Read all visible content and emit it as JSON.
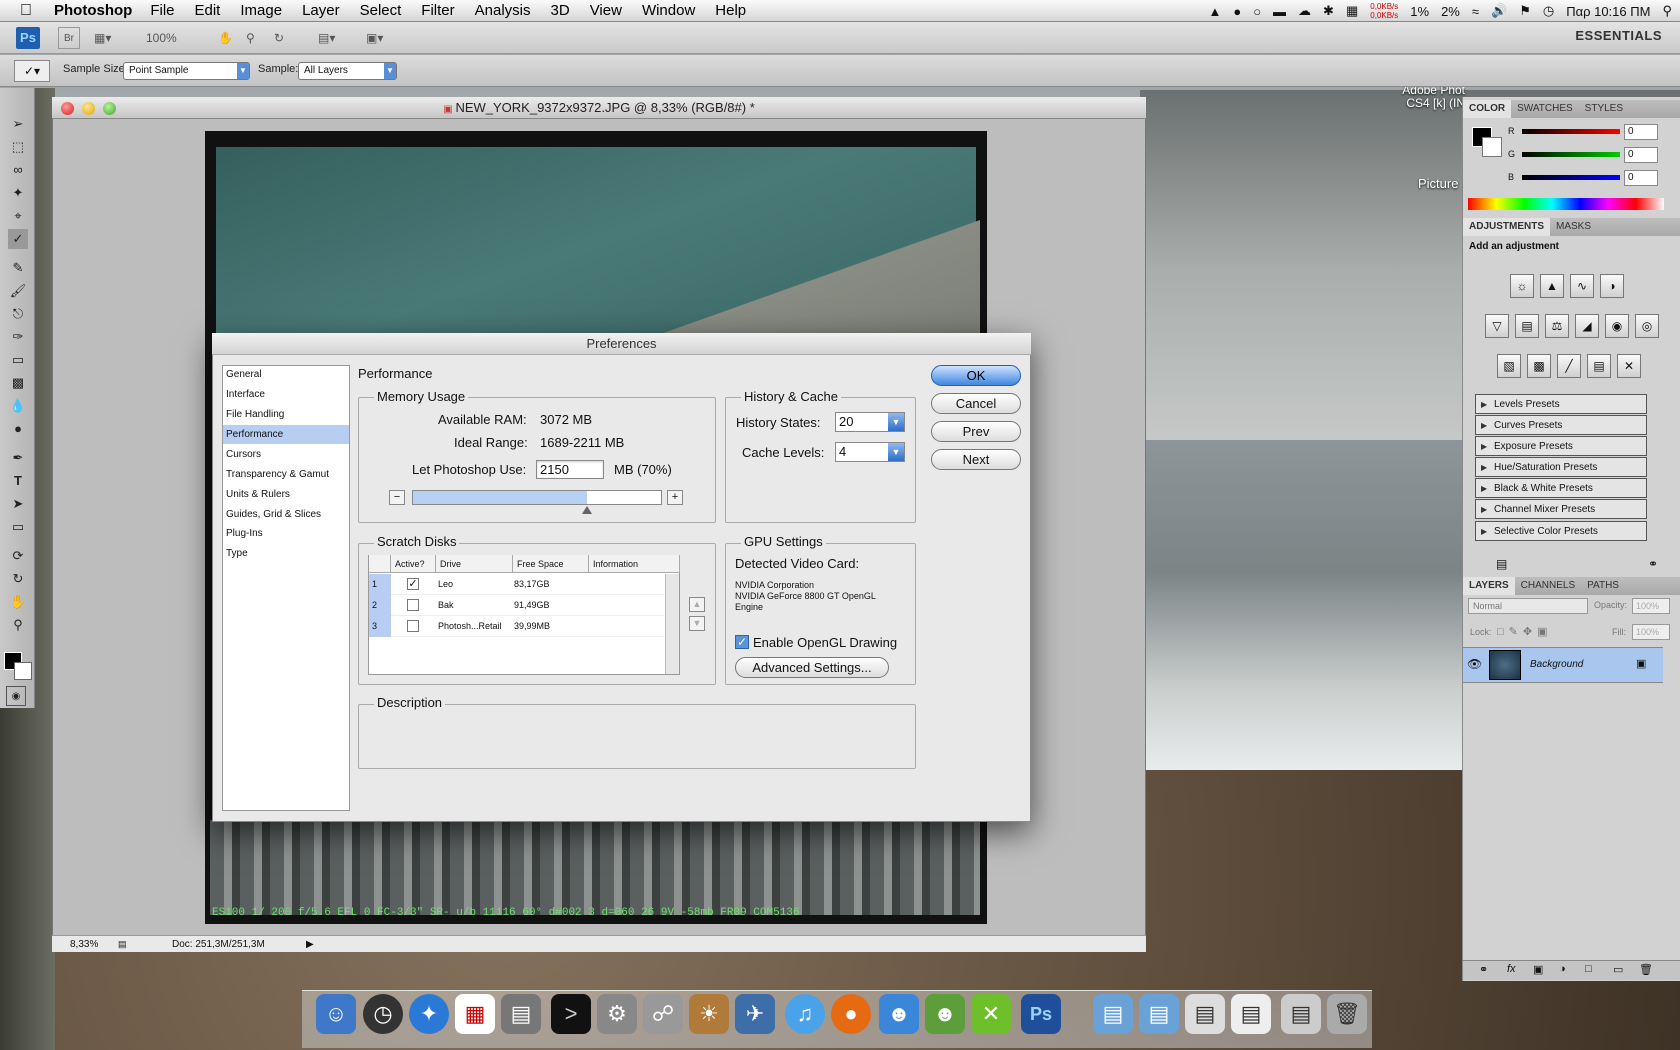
{
  "menubar": {
    "app": "Photoshop",
    "items": [
      "File",
      "Edit",
      "Image",
      "Layer",
      "Select",
      "Filter",
      "Analysis",
      "3D",
      "View",
      "Window",
      "Help"
    ],
    "net_up": "0,0KB/s",
    "net_down": "0,0KB/s",
    "cpu1": "1%",
    "cpu2": "2%",
    "clock": "Παρ 10:16 ΠΜ"
  },
  "appbar": {
    "ps": "Ps",
    "br": "Br",
    "zoom": "100%",
    "workspace": "ESSENTIALS"
  },
  "options": {
    "sample_size_label": "Sample Size:",
    "sample_size": "Point Sample",
    "sample_label": "Sample:",
    "sample": "All Layers"
  },
  "document": {
    "title": "NEW_YORK_9372x9372.JPG @ 8,33% (RGB/8#) *",
    "zoom": "8,33%",
    "doc_info": "Doc: 251,3M/251,3M",
    "film_text": "ES100 1/ 200 f/5.6     EFL 0  FC-3/3\" SR- u/b 11116  60° d#002 3  d=060  26 9V  -58mb FR09 COM5136"
  },
  "desktop": {
    "label1": "Adobe Phot",
    "label2": "CS4 [k] (IN",
    "picture": "Picture"
  },
  "panels": {
    "color_tabs": [
      "COLOR",
      "SWATCHES",
      "STYLES"
    ],
    "r": "R",
    "g": "G",
    "b": "B",
    "r_val": "0",
    "g_val": "0",
    "b_val": "0",
    "adj_tabs": [
      "ADJUSTMENTS",
      "MASKS"
    ],
    "add_adjustment": "Add an adjustment",
    "presets": [
      "Levels Presets",
      "Curves Presets",
      "Exposure Presets",
      "Hue/Saturation Presets",
      "Black & White Presets",
      "Channel Mixer Presets",
      "Selective Color Presets"
    ],
    "layer_tabs": [
      "LAYERS",
      "CHANNELS",
      "PATHS"
    ],
    "blend": "Normal",
    "opacity_label": "Opacity:",
    "opacity": "100%",
    "lock_label": "Lock:",
    "fill_label": "Fill:",
    "fill": "100%",
    "layer_name": "Background"
  },
  "prefs": {
    "title": "Preferences",
    "heading": "Performance",
    "categories": [
      "General",
      "Interface",
      "File Handling",
      "Performance",
      "Cursors",
      "Transparency & Gamut",
      "Units & Rulers",
      "Guides, Grid & Slices",
      "Plug-Ins",
      "Type"
    ],
    "memory": {
      "title": "Memory Usage",
      "avail_label": "Available RAM:",
      "avail": "3072 MB",
      "ideal_label": "Ideal Range:",
      "ideal": "1689-2211 MB",
      "use_label": "Let Photoshop Use:",
      "use": "2150",
      "use_unit": "MB (70%)",
      "slider": 0.7,
      "minus": "−",
      "plus": "+"
    },
    "history": {
      "title": "History & Cache",
      "states_label": "History States:",
      "states": "20",
      "cache_label": "Cache Levels:",
      "cache": "4"
    },
    "buttons": {
      "ok": "OK",
      "cancel": "Cancel",
      "prev": "Prev",
      "next": "Next",
      "advanced": "Advanced Settings..."
    },
    "scratch": {
      "title": "Scratch Disks",
      "cols": [
        "Active?",
        "Drive",
        "Free Space",
        "Information"
      ],
      "rows": [
        {
          "n": "1",
          "check": "✓",
          "drive": "Leo",
          "free": "83,17GB"
        },
        {
          "n": "2",
          "check": "",
          "drive": "Bak",
          "free": "91,49GB"
        },
        {
          "n": "3",
          "check": "",
          "drive": "Photosh...Retail",
          "free": "39,99MB"
        }
      ]
    },
    "gpu": {
      "title": "GPU Settings",
      "detected": "Detected Video Card:",
      "line1": "NVIDIA Corporation",
      "line2": "NVIDIA GeForce 8800 GT OpenGL",
      "line3": "Engine",
      "opengl_check": "✓",
      "opengl": "Enable OpenGL Drawing"
    },
    "description": "Description"
  }
}
